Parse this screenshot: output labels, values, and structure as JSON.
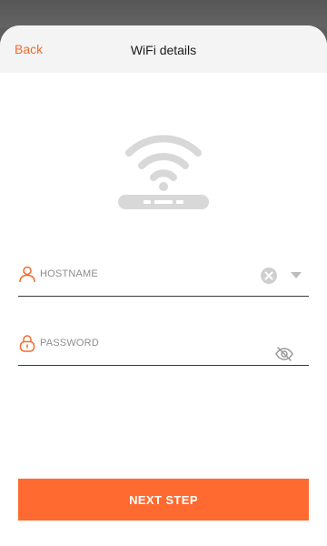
{
  "header": {
    "back_label": "Back",
    "title": "WiFi details"
  },
  "hero": {
    "icon": "wifi-router-icon"
  },
  "form": {
    "hostname": {
      "placeholder": "HOSTNAME",
      "icon": "user-icon",
      "clear_icon": "clear-icon",
      "dropdown_icon": "dropdown-arrow-icon"
    },
    "password": {
      "placeholder": "PASSWORD",
      "icon": "lock-icon",
      "visibility_icon": "eye-off-icon"
    }
  },
  "actions": {
    "next_label": "NEXT STEP"
  },
  "colors": {
    "accent": "#fe6a2f",
    "header_bg": "#f4f4f4",
    "icon_grey": "#d8d8d8"
  }
}
